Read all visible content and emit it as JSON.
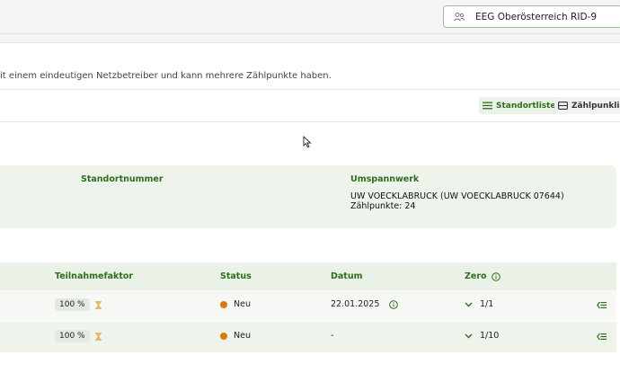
{
  "topbar": {
    "eeg_label": "EEG Oberösterreich RID-9"
  },
  "description": "it einem eindeutigen Netzbetreiber und kann mehrere Zählpunkte haben.",
  "tabs": [
    {
      "label": "Standortliste",
      "active": true
    },
    {
      "label": "Zählpunkliste",
      "active": false
    }
  ],
  "location": {
    "standortnummer_label": "Standortnummer",
    "umspannwerk_label": "Umspannwerk",
    "umspannwerk_value": "UW VOECKLABRUCK (UW VOECKLABRUCK 07644)",
    "zaehlpunkte": "Zählpunkte: 24"
  },
  "table": {
    "headers": {
      "teilnahmefaktor": "Teilnahmefaktor",
      "status": "Status",
      "datum": "Datum",
      "zero": "Zero"
    },
    "rows": [
      {
        "teilnahmefaktor": "100 %",
        "status": "Neu",
        "datum": "22.01.2025",
        "zero": "1/1"
      },
      {
        "teilnahmefaktor": "100 %",
        "status": "Neu",
        "datum": "-",
        "zero": "1/10"
      }
    ]
  },
  "colors": {
    "accent": "#2f6e1e",
    "status_new": "#d97a0f",
    "panel_bg": "#eef4ec"
  },
  "icons": [
    "users-icon",
    "list-icon",
    "table-icon",
    "info-icon",
    "hourglass-icon",
    "chevron-down-icon",
    "collapse-list-icon",
    "mouse-cursor-icon"
  ]
}
